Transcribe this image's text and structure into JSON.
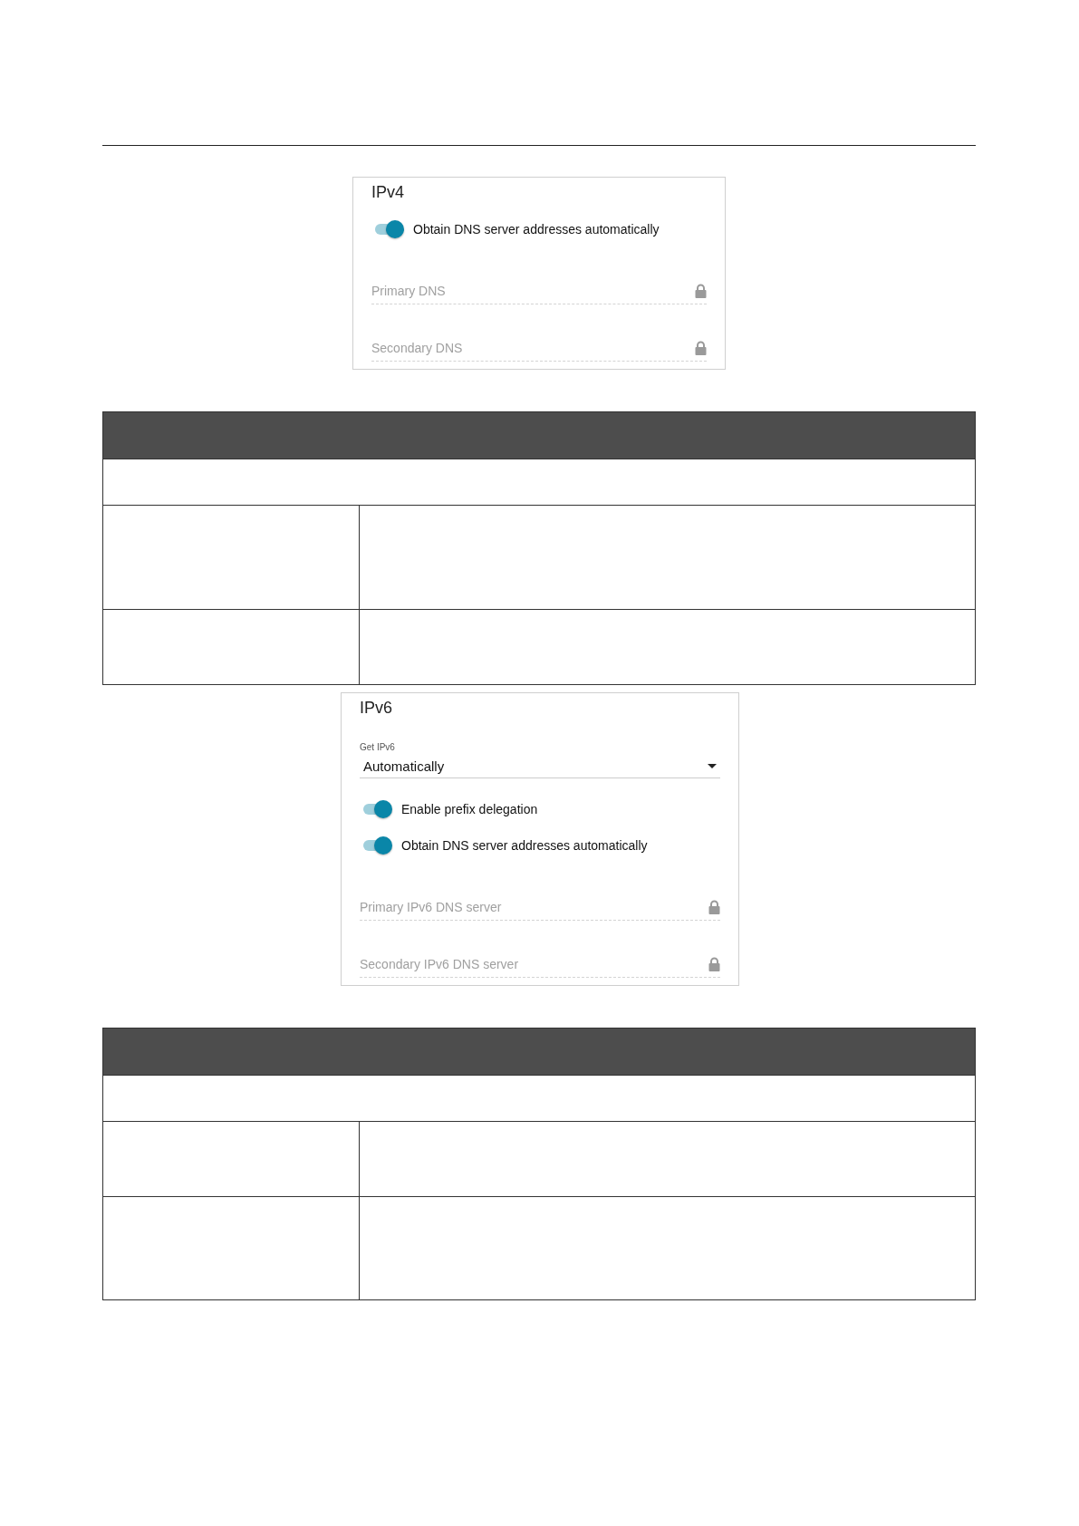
{
  "ipv4": {
    "title": "IPv4",
    "toggles": [
      {
        "label": "Obtain DNS server addresses automatically",
        "on": true
      }
    ],
    "fields": [
      {
        "placeholder": "Primary DNS",
        "locked": true
      },
      {
        "placeholder": "Secondary DNS",
        "locked": true
      }
    ]
  },
  "ipv6": {
    "title": "IPv6",
    "select": {
      "label": "Get IPv6",
      "value": "Automatically"
    },
    "toggles": [
      {
        "label": "Enable prefix delegation",
        "on": true
      },
      {
        "label": "Obtain DNS server addresses automatically",
        "on": true
      }
    ],
    "fields": [
      {
        "placeholder": "Primary IPv6 DNS server",
        "locked": true
      },
      {
        "placeholder": "Secondary IPv6 DNS server",
        "locked": true
      }
    ]
  }
}
